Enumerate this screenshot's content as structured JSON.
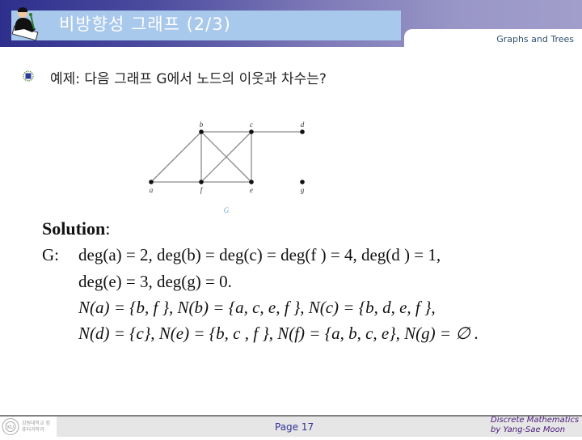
{
  "header": {
    "title": "비방향성 그래프 (2/3)",
    "subject": "Graphs and Trees",
    "logo_icon": "person-writing-icon"
  },
  "question": {
    "bullet_icon": "bullet-emblem-icon",
    "text": "예제: 다음 그래프 G에서 노드의 이웃과 차수는?"
  },
  "graph": {
    "name": "G",
    "nodes": [
      {
        "id": "a",
        "label": "a"
      },
      {
        "id": "b",
        "label": "b"
      },
      {
        "id": "c",
        "label": "c"
      },
      {
        "id": "d",
        "label": "d"
      },
      {
        "id": "e",
        "label": "e"
      },
      {
        "id": "f",
        "label": "f"
      },
      {
        "id": "g",
        "label": "g"
      }
    ],
    "edges": [
      [
        "a",
        "b"
      ],
      [
        "a",
        "f"
      ],
      [
        "b",
        "c"
      ],
      [
        "b",
        "f"
      ],
      [
        "b",
        "e"
      ],
      [
        "c",
        "d"
      ],
      [
        "c",
        "e"
      ],
      [
        "c",
        "f"
      ],
      [
        "f",
        "e"
      ]
    ],
    "colors": {
      "edge": "#8a8a8a",
      "node": "#111111",
      "caption": "#6aa6c8"
    }
  },
  "solution": {
    "title": "Solution",
    "label": "G:",
    "degree_line1": "deg(a) = 2, deg(b) = deg(c) = deg(f ) = 4, deg(d ) = 1,",
    "degree_line2": "deg(e) = 3, deg(g) = 0.",
    "neighbor_line1": "N(a) = {b, f }, N(b) = {a, c, e, f }, N(c) = {b, d, e, f },",
    "neighbor_line2": "N(d) = {c}, N(e) = {b, c , f }, N(f) = {a, b, c, e}, N(g) = ∅ ."
  },
  "footer": {
    "logo_text": "강원대학교 컴퓨터과학과",
    "page": "Page 17",
    "credit_line1": "Discrete Mathematics",
    "credit_line2": "by Yang-Sae Moon"
  }
}
